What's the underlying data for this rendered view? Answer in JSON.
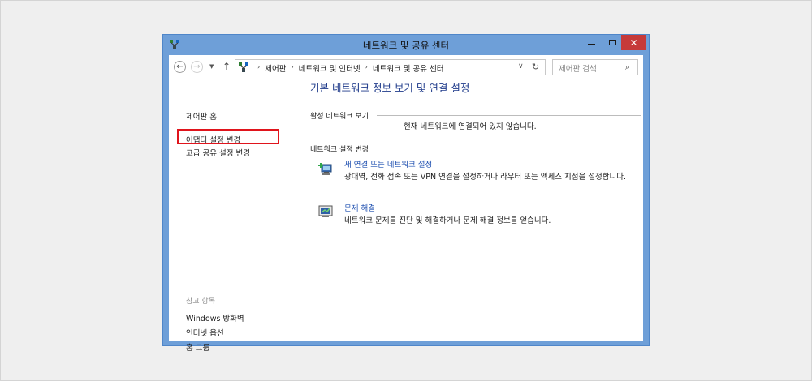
{
  "window": {
    "title": "네트워크 및 공유 센터",
    "controls": {
      "minimize": "–",
      "maximize": "□",
      "close": "✕"
    },
    "accent": "#6e9fd8",
    "close_color": "#c63a3a"
  },
  "nav": {
    "back": "←",
    "forward": "→",
    "recent": "▼",
    "up": "↑",
    "breadcrumbs": [
      "제어판",
      "네트워크 및 인터넷",
      "네트워크 및 공유 센터"
    ],
    "separator": "›",
    "dropdown": "∨",
    "refresh": "↻",
    "search_placeholder": "제어판 검색",
    "search_icon": "⌕"
  },
  "sidebar": {
    "home": "제어판 홈",
    "adapter": "어댑터 설정 변경",
    "advanced": "고급 공유 설정 변경",
    "see_also": "참고 항목",
    "links": [
      "Windows 방화벽",
      "인터넷 옵션",
      "홈 그룹"
    ]
  },
  "main": {
    "title": "기본 네트워크 정보 보기 및 연결 설정",
    "active_networks_label": "활성 네트워크 보기",
    "no_connection_text": "현재 네트워크에 연결되어 있지 않습니다.",
    "change_settings_label": "네트워크 설정 변경",
    "tasks": [
      {
        "icon": "new-connection-icon",
        "link": "새 연결 또는 네트워크 설정",
        "desc": "광대역, 전화 접속 또는 VPN 연결을 설정하거나 라우터 또는 액세스 지점을 설정합니다."
      },
      {
        "icon": "troubleshoot-icon",
        "link": "문제 해결",
        "desc": "네트워크 문제를 진단 및 해결하거나 문제 해결 정보를 얻습니다."
      }
    ]
  },
  "highlight_color": "#e0141c"
}
